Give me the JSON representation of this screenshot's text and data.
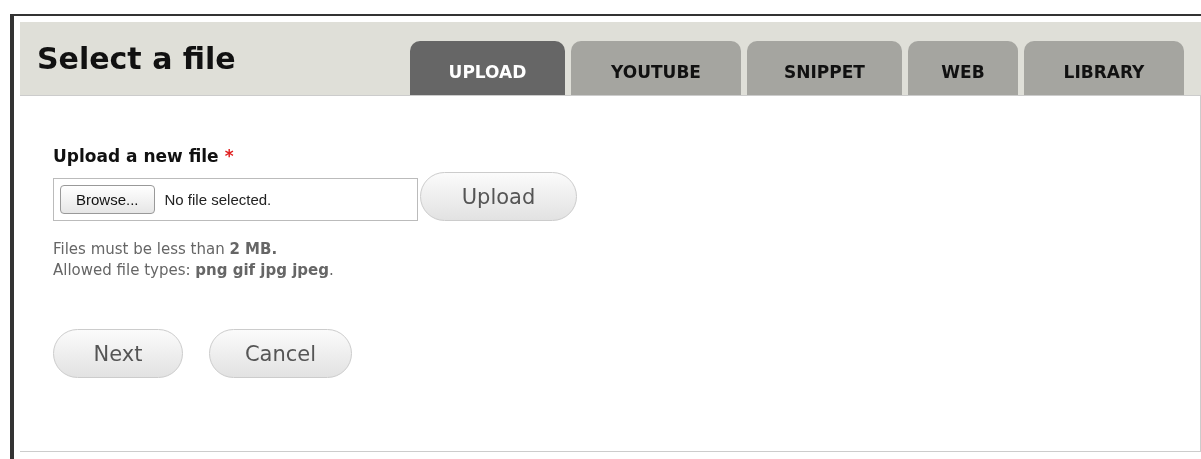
{
  "dialog": {
    "title": "Select a file"
  },
  "tabs": [
    {
      "label": "UPLOAD",
      "selected": true
    },
    {
      "label": "YOUTUBE",
      "selected": false
    },
    {
      "label": "SNIPPET",
      "selected": false
    },
    {
      "label": "WEB",
      "selected": false
    },
    {
      "label": "LIBRARY",
      "selected": false
    }
  ],
  "file_field": {
    "label": "Upload a new file",
    "required": true,
    "required_mark": "*",
    "browse_button": "Browse...",
    "status": "No file selected."
  },
  "upload_button": "Upload",
  "help": [
    "Files must be less than **2 MB.**",
    "Allowed file types: **png gif jpg jpeg**."
  ],
  "buttons": [
    "Next",
    "Cancel"
  ]
}
